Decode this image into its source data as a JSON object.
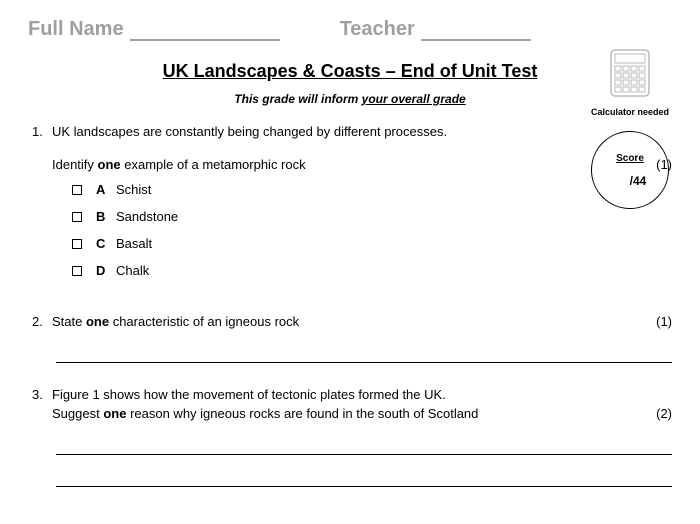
{
  "header": {
    "name_label": "Full Name",
    "teacher_label": "Teacher"
  },
  "title": "UK Landscapes & Coasts – End of Unit Test",
  "subtitle_pre": "This grade will inform ",
  "subtitle_ul": "your overall grade",
  "sidebar": {
    "calc_label": "Calculator needed",
    "score_label": "Score",
    "score_total": "/44"
  },
  "q1": {
    "num": "1.",
    "intro": "UK landscapes are constantly being changed by different processes.",
    "prompt_pre": "Identify ",
    "prompt_bold": "one",
    "prompt_post": " example of a metamorphic rock",
    "marks": "(1)",
    "optA_letter": "A",
    "optA_text": "Schist",
    "optB_letter": "B",
    "optB_text": "Sandstone",
    "optC_letter": "C",
    "optC_text": "Basalt",
    "optD_letter": "D",
    "optD_text": "Chalk"
  },
  "q2": {
    "num": "2.",
    "prompt_pre": "State ",
    "prompt_bold": "one",
    "prompt_post": " characteristic of an igneous rock",
    "marks": "(1)"
  },
  "q3": {
    "num": "3.",
    "line1": "Figure 1 shows how the movement of tectonic plates formed the UK.",
    "line2_pre": "Suggest ",
    "line2_bold": "one",
    "line2_post": " reason why igneous rocks are found in the south of Scotland",
    "marks": "(2)"
  }
}
